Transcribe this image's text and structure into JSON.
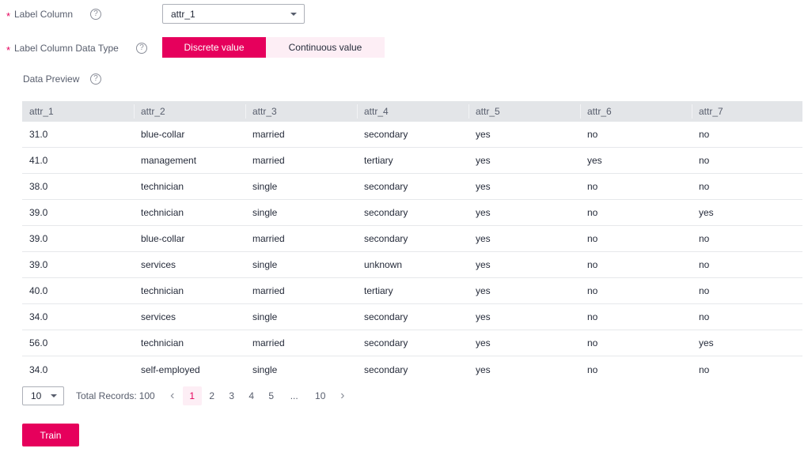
{
  "form": {
    "label_column": {
      "required_mark": "*",
      "label": "Label Column",
      "help_icon": "?",
      "value": "attr_1"
    },
    "label_type": {
      "required_mark": "*",
      "label": "Label Column Data Type",
      "help_icon": "?",
      "options": [
        "Discrete value",
        "Continuous value"
      ],
      "selected": "Discrete value"
    },
    "preview": {
      "label": "Data Preview",
      "help_icon": "?"
    }
  },
  "table": {
    "columns": [
      "attr_1",
      "attr_2",
      "attr_3",
      "attr_4",
      "attr_5",
      "attr_6",
      "attr_7"
    ],
    "rows": [
      [
        "31.0",
        "blue-collar",
        "married",
        "secondary",
        "yes",
        "no",
        "no"
      ],
      [
        "41.0",
        "management",
        "married",
        "tertiary",
        "yes",
        "yes",
        "no"
      ],
      [
        "38.0",
        "technician",
        "single",
        "secondary",
        "yes",
        "no",
        "no"
      ],
      [
        "39.0",
        "technician",
        "single",
        "secondary",
        "yes",
        "no",
        "yes"
      ],
      [
        "39.0",
        "blue-collar",
        "married",
        "secondary",
        "yes",
        "no",
        "no"
      ],
      [
        "39.0",
        "services",
        "single",
        "unknown",
        "yes",
        "no",
        "no"
      ],
      [
        "40.0",
        "technician",
        "married",
        "tertiary",
        "yes",
        "no",
        "no"
      ],
      [
        "34.0",
        "services",
        "single",
        "secondary",
        "yes",
        "no",
        "no"
      ],
      [
        "56.0",
        "technician",
        "married",
        "secondary",
        "yes",
        "no",
        "yes"
      ],
      [
        "34.0",
        "self-employed",
        "single",
        "secondary",
        "yes",
        "no",
        "no"
      ]
    ]
  },
  "pagination": {
    "page_size": "10",
    "total_label": "Total Records:",
    "total": "100",
    "prev_icon": "‹",
    "next_icon": "›",
    "pages": [
      "1",
      "2",
      "3",
      "4",
      "5",
      "...",
      "10"
    ],
    "current_page": "1"
  },
  "actions": {
    "train_label": "Train"
  },
  "colors": {
    "accent": "#e6005c",
    "accent_light": "#fdeef5",
    "header_bg": "#e3e5e8"
  }
}
